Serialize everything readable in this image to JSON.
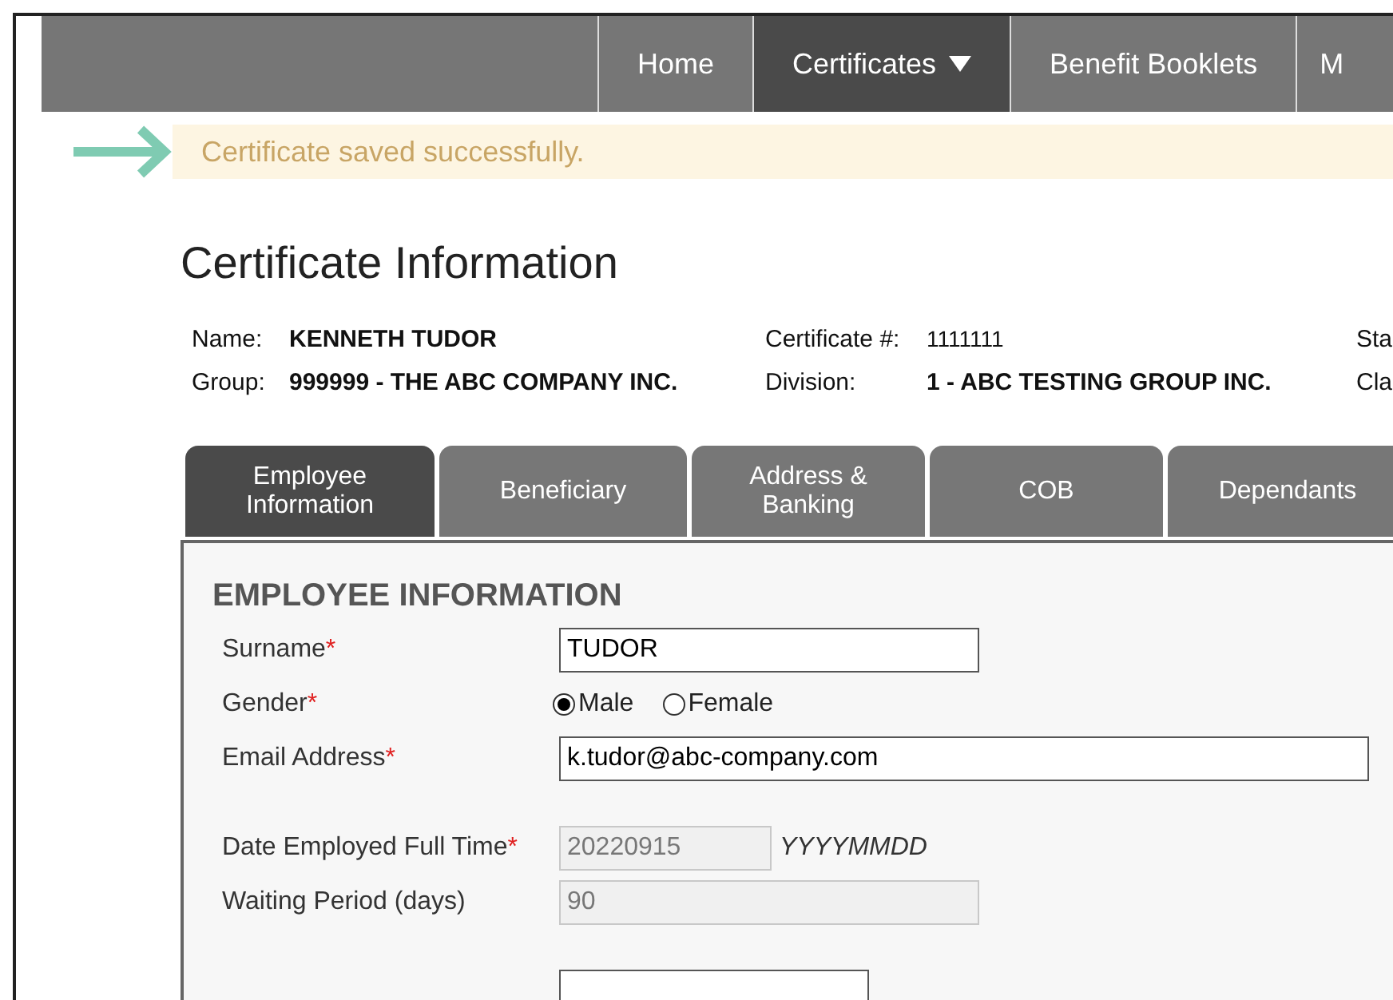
{
  "nav": [
    {
      "label": "Home",
      "selected": false,
      "dropdown": false
    },
    {
      "label": "Certificates",
      "selected": true,
      "dropdown": true
    },
    {
      "label": "Benefit Booklets",
      "selected": false,
      "dropdown": false
    },
    {
      "label": "M",
      "selected": false,
      "dropdown": false
    }
  ],
  "message": "Certificate saved successfully.",
  "title": "Certificate Information",
  "info": [
    [
      {
        "label": "Name:",
        "value": "KENNETH TUDOR"
      },
      {
        "label": "Group:",
        "value": "999999 - THE ABC COMPANY INC."
      }
    ],
    [
      {
        "label": "Certificate #:",
        "value": "1111111",
        "bold": false
      },
      {
        "label": "Division:",
        "value": "1 - ABC TESTING GROUP INC.",
        "bold": true
      }
    ],
    [
      {
        "label": "Sta"
      },
      {
        "label": "Cla"
      }
    ]
  ],
  "tabs": [
    {
      "label": "Employee Information",
      "selected": true
    },
    {
      "label": "Beneficiary",
      "selected": false
    },
    {
      "label": "Address & Banking",
      "selected": false
    },
    {
      "label": "COB",
      "selected": false
    },
    {
      "label": "Dependants",
      "selected": false
    }
  ],
  "section": "EMPLOYEE INFORMATION",
  "fields": [
    {
      "kind": "text",
      "label": "Surname",
      "required_mark": "*",
      "value": "TUDOR",
      "disabled": false
    },
    {
      "kind": "radio",
      "label": "Gender",
      "required_mark": "*",
      "options": [
        {
          "label": "Male",
          "selected": true
        },
        {
          "label": "Female",
          "selected": false
        }
      ]
    },
    {
      "kind": "text",
      "label": "Email Address",
      "required_mark": "*",
      "value": "k.tudor@abc-company.com",
      "disabled": false
    },
    {
      "kind": "gap"
    },
    {
      "kind": "text",
      "label": "Date Employed Full Time",
      "required_mark": "*",
      "value": "20220915",
      "disabled": true,
      "hint": "YYYYMMDD"
    },
    {
      "kind": "text",
      "label": "Waiting Period (days)",
      "value": "90",
      "disabled": true
    },
    {
      "kind": "gap"
    },
    {
      "kind": "text",
      "disabled": false
    }
  ]
}
